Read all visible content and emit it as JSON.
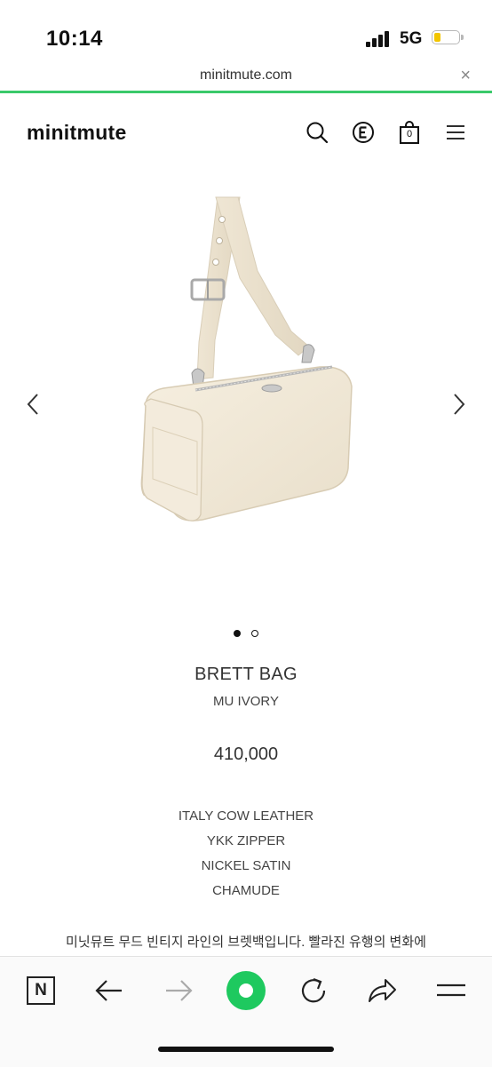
{
  "status_bar": {
    "time": "10:14",
    "network": "5G",
    "battery_color": "#f2c500"
  },
  "browser": {
    "url": "minitmute.com",
    "close_label": "×",
    "progress_color": "#3ac96a"
  },
  "site": {
    "logo": "minitmute",
    "header_icons": [
      "search-icon",
      "e-icon",
      "cart-icon",
      "menu-icon"
    ],
    "cart_count": "0"
  },
  "product": {
    "name": "BRETT BAG",
    "color": "MU IVORY",
    "price": "410,000",
    "specs": [
      "ITALY COW LEATHER",
      "YKK ZIPPER",
      "NICKEL SATIN",
      "CHAMUDE"
    ],
    "description": "미닛뮤트 무드 빈티지 라인의 브렛백입니다. 빨라진 유행의 변화에",
    "image_count": 2,
    "active_image": 1
  },
  "toolbar": {
    "icons": [
      "naver-n-icon",
      "back-arrow-icon",
      "forward-arrow-icon",
      "home-green-icon",
      "refresh-icon",
      "share-icon",
      "menu-icon"
    ],
    "naver_letter": "N",
    "accent": "#1ec95f"
  }
}
